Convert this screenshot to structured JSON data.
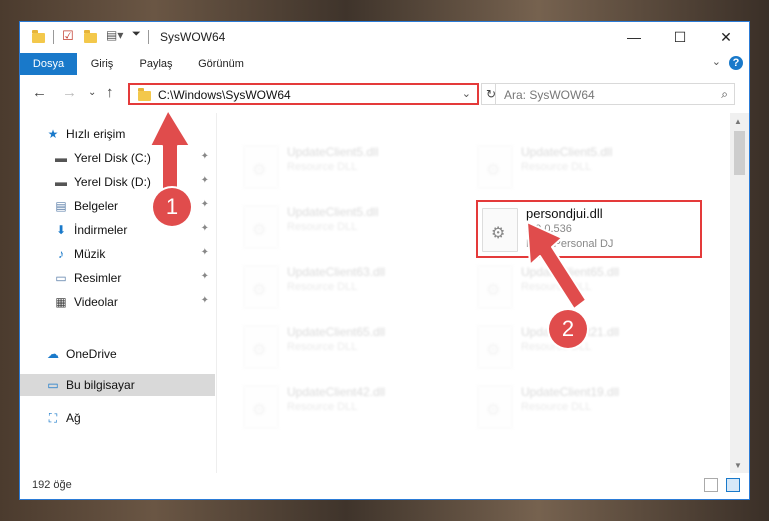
{
  "window": {
    "title": "SysWOW64",
    "controls": {
      "minimize": "—",
      "maximize": "☐",
      "close": "✕"
    }
  },
  "ribbon": {
    "tabs": [
      {
        "label": "Dosya",
        "active": true
      },
      {
        "label": "Giriş"
      },
      {
        "label": "Paylaş"
      },
      {
        "label": "Görünüm"
      }
    ],
    "help": "?"
  },
  "address": {
    "path": "C:\\Windows\\SysWOW64",
    "search_placeholder": "Ara: SysWOW64"
  },
  "sidebar": {
    "items": [
      {
        "label": "Hızlı erişim",
        "icon": "star-icon"
      },
      {
        "label": "Yerel Disk (C:)",
        "icon": "drive-icon",
        "pinned": true
      },
      {
        "label": "Yerel Disk (D:)",
        "icon": "drive-icon",
        "pinned": true
      },
      {
        "label": "Belgeler",
        "icon": "documents-icon",
        "pinned": true
      },
      {
        "label": "İndirmeler",
        "icon": "download-icon",
        "pinned": true
      },
      {
        "label": "Müzik",
        "icon": "music-icon",
        "pinned": true
      },
      {
        "label": "Resimler",
        "icon": "pictures-icon",
        "pinned": true
      },
      {
        "label": "Videolar",
        "icon": "videos-icon",
        "pinned": true
      },
      {
        "label": "OneDrive",
        "icon": "cloud-icon"
      },
      {
        "label": "Bu bilgisayar",
        "icon": "computer-icon",
        "selected": true
      },
      {
        "label": "Ağ",
        "icon": "network-icon"
      }
    ]
  },
  "files": {
    "left": [
      {
        "name": "UpdateClient5.dll",
        "desc": "Resource DLL"
      },
      {
        "name": "UpdateClient5.dll",
        "desc": "Resource DLL"
      },
      {
        "name": "UpdateClient63.dll",
        "desc": "Resource DLL"
      },
      {
        "name": "UpdateClient65.dll",
        "desc": "Resource DLL"
      },
      {
        "name": "UpdateClient42.dll",
        "desc": "Resource DLL"
      }
    ],
    "right": [
      {
        "name": "UpdateClient5.dll",
        "desc": "Resource DLL"
      },
      {
        "name": "UpdateClient65.dll",
        "desc": "Resource DLL"
      },
      {
        "name": "UpdateClient21.dll",
        "desc": "Resource DLL"
      },
      {
        "name": "UpdateClient19.dll",
        "desc": "Resource DLL"
      }
    ],
    "highlighted": {
      "name": "persondjui.dll",
      "version": "1.0.0.536",
      "desc": "Plus! Personal DJ"
    }
  },
  "status": {
    "count": "192 öğe"
  },
  "annotations": {
    "step1": "1",
    "step2": "2",
    "color": "#e04c4c"
  }
}
